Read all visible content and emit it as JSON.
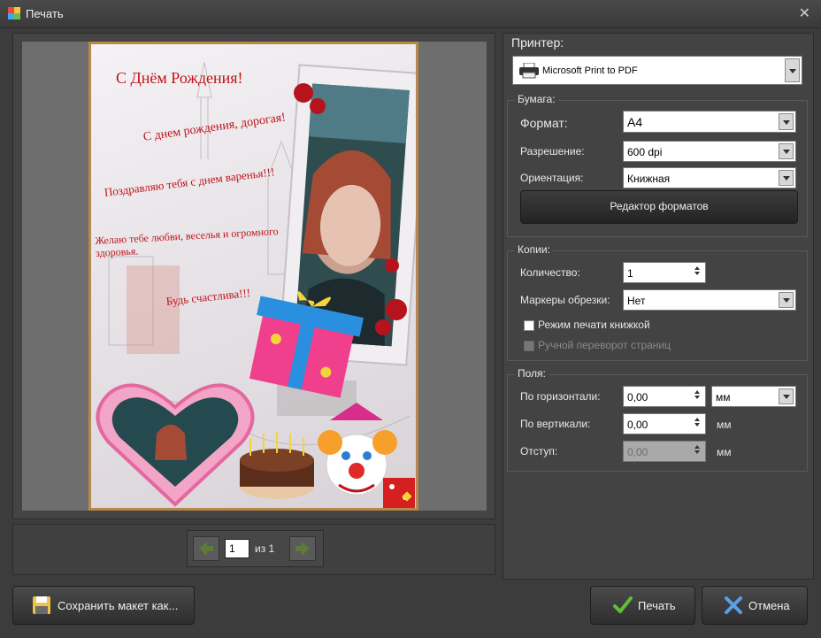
{
  "window": {
    "title": "Печать",
    "close_glyph": "✕"
  },
  "preview": {
    "card_texts": {
      "title": "С Днём Рождения!",
      "line1": "С днем рождения, дорогая!",
      "line2": "Поздравляю тебя с днем варенья!!!",
      "line3": "Желаю тебе любви, веселья и огромного здоровья.",
      "line4": "Будь счастлива!!!"
    }
  },
  "navigation": {
    "page_value": "1",
    "of_text": "из 1"
  },
  "printer": {
    "label": "Принтер:",
    "name": "Microsoft Print to PDF",
    "icon": "printer-icon"
  },
  "paper": {
    "title": "Бумага:",
    "format_label": "Формат:",
    "format_value": "A4",
    "resolution_label": "Разрешение:",
    "resolution_value": "600 dpi",
    "orientation_label": "Ориентация:",
    "orientation_value": "Книжная",
    "editor_button": "Редактор форматов"
  },
  "copies": {
    "title": "Копии:",
    "count_label": "Количество:",
    "count_value": "1",
    "crop_label": "Маркеры обрезки:",
    "crop_value": "Нет",
    "booklet_label": "Режим печати книжкой",
    "manual_flip_label": "Ручной переворот страниц"
  },
  "margins": {
    "title": "Поля:",
    "horizontal_label": "По горизонтали:",
    "horizontal_value": "0,00",
    "unit_select": "мм",
    "vertical_label": "По вертикали:",
    "vertical_value": "0,00",
    "vertical_unit": "мм",
    "indent_label": "Отступ:",
    "indent_value": "0,00",
    "indent_unit": "мм"
  },
  "buttons": {
    "save_layout": "Сохранить макет как...",
    "print": "Печать",
    "cancel": "Отмена"
  },
  "colors": {
    "accent_green": "#5fbf3a",
    "cancel_blue": "#5aa0e8",
    "dialog_bg": "#3c3c3c",
    "card_frame": "#b8884a"
  }
}
